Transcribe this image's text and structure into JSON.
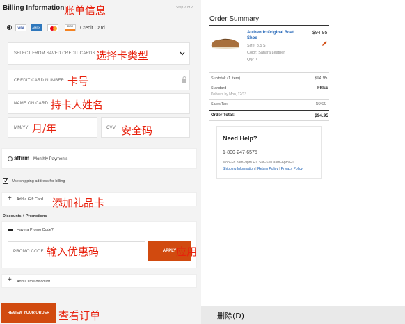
{
  "billing": {
    "title": "Billing Information",
    "step": "Step 2 of 2",
    "credit_card_label": "Credit Card",
    "card_brands": [
      "VISA",
      "AMEX",
      "MC",
      "DISC"
    ],
    "saved_cards_select": "SELECT FROM SAVED CREDIT CARDS",
    "card_number_placeholder": "CREDIT CARD NUMBER",
    "name_on_card_placeholder": "NAME ON CARD",
    "expiry_placeholder": "MM/YY",
    "cvv_placeholder": "CVV",
    "affirm_logo": "affirm",
    "affirm_label": "Monthly Payments",
    "use_shipping_label": "Use shipping address for billing",
    "gift_card_label": "Add a Gift Card",
    "discounts_heading": "Discounts + Promotions",
    "promo_question": "Have a Promo Code?",
    "promo_placeholder": "PROMO CODE",
    "apply_label": "APPLY",
    "idme_label": "Add ID.me discount",
    "review_button": "REVIEW YOUR ORDER"
  },
  "annotations": {
    "billing_info": "账单信息",
    "card_type": "选择卡类型",
    "card_number": "卡号",
    "cardholder_name": "持卡人姓名",
    "month_year": "月/年",
    "security_code": "安全码",
    "add_gift_card": "添加礼品卡",
    "enter_promo": "输入优惠码",
    "apply": "应用",
    "review_order": "查看订单"
  },
  "order_summary": {
    "title": "Order Summary",
    "product_name_line1": "Authentic Original Boat",
    "product_name_line2": "Shoe",
    "price": "$94.95",
    "size": "Size: 8.5 S",
    "color": "Color: Sahara Leather",
    "qty": "Qty: 1",
    "subtotal_label": "Subtotal: (1 Item)",
    "subtotal_value": "$94.95",
    "shipping_label": "Standard",
    "shipping_value": "FREE",
    "delivers_by": "Delivers by Mon, 12/13",
    "tax_label": "Sales Tax",
    "tax_value": "$0.00",
    "total_label": "Order Total:",
    "total_value": "$94.95"
  },
  "help": {
    "title": "Need Help?",
    "phone": "1-800-247-6575",
    "hours": "Mon–Fri 8am–9pm ET, Sat–Sun 9am–6pm ET",
    "link_shipping": "Shipping Information",
    "link_return": "Return Policy",
    "link_privacy": "Privacy Policy",
    "separator": "|"
  },
  "context_menu": {
    "delete_label": "删除(D)"
  },
  "colors": {
    "accent": "#d14a0f",
    "annotation": "#e8200c",
    "link": "#1a5fb4"
  }
}
